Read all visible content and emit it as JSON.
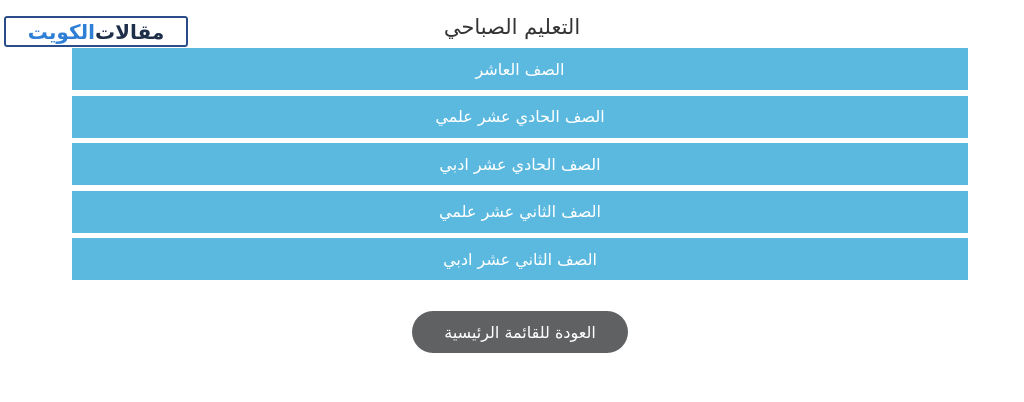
{
  "logo": {
    "word1": "مقالات",
    "word2": "الكويت"
  },
  "page_title": "التعليم الصباحي",
  "grades": [
    {
      "label": "الصف العاشر"
    },
    {
      "label": "الصف الحادي عشر علمي"
    },
    {
      "label": "الصف الحادي عشر ادبي"
    },
    {
      "label": "الصف الثاني عشر علمي"
    },
    {
      "label": "الصف الثاني عشر ادبي"
    }
  ],
  "back_button": {
    "label": "العودة للقائمة الرئيسية"
  },
  "colors": {
    "grade_button_bg": "#5bb9e0",
    "back_button_bg": "#5f6162",
    "logo_border": "#2a4d8a",
    "logo_dark": "#1f2f4a",
    "logo_blue": "#2f7fd6"
  }
}
